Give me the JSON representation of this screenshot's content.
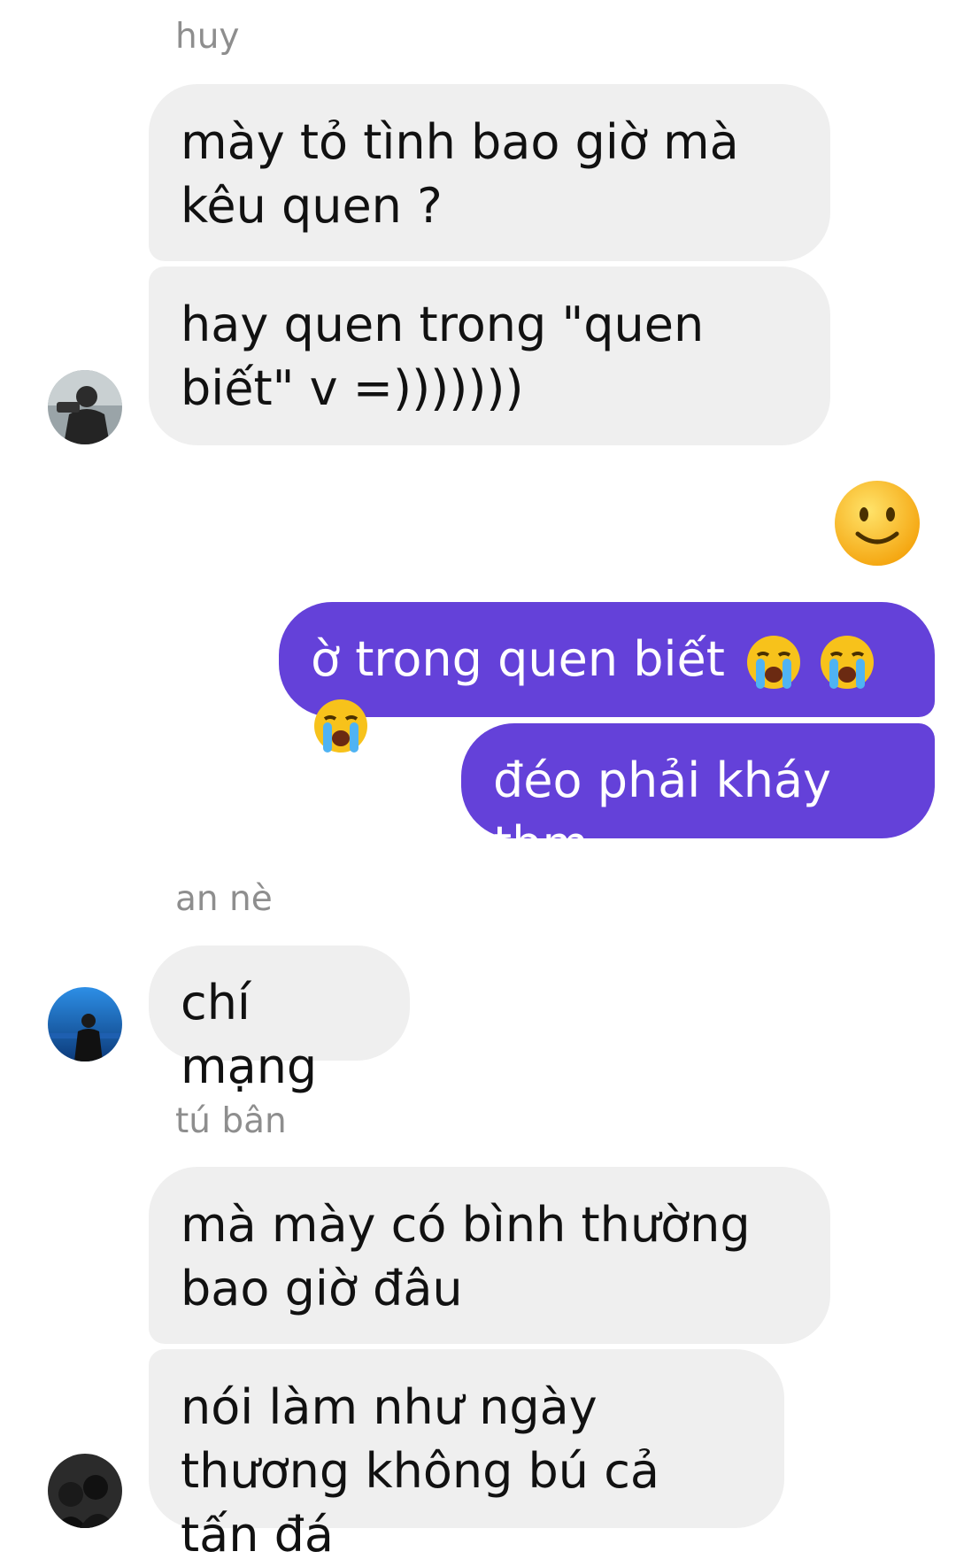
{
  "messages": [
    {
      "sender": "huy"
    },
    {
      "text": "mày tỏ tình bao giờ mà kêu quen ?"
    },
    {
      "text": "hay quen trong \"quen biết\" v =)))))))"
    },
    {
      "reaction_icon": "slightly-smiling-face-emoji"
    },
    {
      "text": "ờ trong quen biết",
      "emoji": "loudly-crying-face-emoji",
      "emoji_count": 3
    },
    {
      "text": "đéo phải kháy tbm"
    },
    {
      "sender": "an nè"
    },
    {
      "text": "chí mạng"
    },
    {
      "sender": "tú bân"
    },
    {
      "text": "mà mày có bình thường bao giờ đâu"
    },
    {
      "text": "nói làm như ngày thương không bú cả tấn đá"
    }
  ],
  "colors": {
    "incoming_bubble": "#efefef",
    "outgoing_bubble": "#6441d9",
    "sender_name": "#8e8e8e"
  }
}
